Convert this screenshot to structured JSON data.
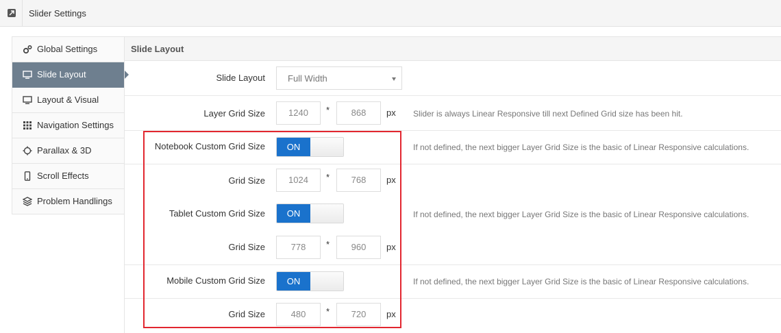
{
  "header": {
    "title": "Slider Settings",
    "icon": "expand-icon"
  },
  "sidebar": {
    "items": [
      {
        "label": "Global Settings",
        "icon": "cogs-icon"
      },
      {
        "label": "Slide Layout",
        "icon": "desktop-icon",
        "active": true
      },
      {
        "label": "Layout & Visual",
        "icon": "desktop-icon"
      },
      {
        "label": "Navigation Settings",
        "icon": "grid-icon"
      },
      {
        "label": "Parallax & 3D",
        "icon": "crosshair-icon"
      },
      {
        "label": "Scroll Effects",
        "icon": "mobile-icon"
      },
      {
        "label": "Problem Handlings",
        "icon": "layers-icon"
      }
    ]
  },
  "main": {
    "section_title": "Slide Layout",
    "slide_layout": {
      "label": "Slide Layout",
      "value": "Full Width"
    },
    "layer_grid": {
      "label": "Layer Grid Size",
      "width": "1240",
      "sep": "*",
      "height": "868",
      "unit": "px",
      "hint": "Slider is always Linear Responsive till next Defined Grid size has been hit."
    },
    "notebook": {
      "label": "Notebook Custom Grid Size",
      "toggle": "ON",
      "hint": "If not defined, the next bigger Layer Grid Size is the basic of Linear Responsive calculations.",
      "grid_label": "Grid Size",
      "width": "1024",
      "sep": "*",
      "height": "768",
      "unit": "px"
    },
    "tablet": {
      "label": "Tablet Custom Grid Size",
      "toggle": "ON",
      "hint": "If not defined, the next bigger Layer Grid Size is the basic of Linear Responsive calculations.",
      "grid_label": "Grid Size",
      "width": "778",
      "sep": "*",
      "height": "960",
      "unit": "px"
    },
    "mobile": {
      "label": "Mobile Custom Grid Size",
      "toggle": "ON",
      "hint": "If not defined, the next bigger Layer Grid Size is the basic of Linear Responsive calculations.",
      "grid_label": "Grid Size",
      "width": "480",
      "sep": "*",
      "height": "720",
      "unit": "px"
    }
  },
  "colors": {
    "active_tab": "#6e7f8f",
    "toggle_on": "#1a72cc",
    "highlight_box": "#e2262f"
  }
}
